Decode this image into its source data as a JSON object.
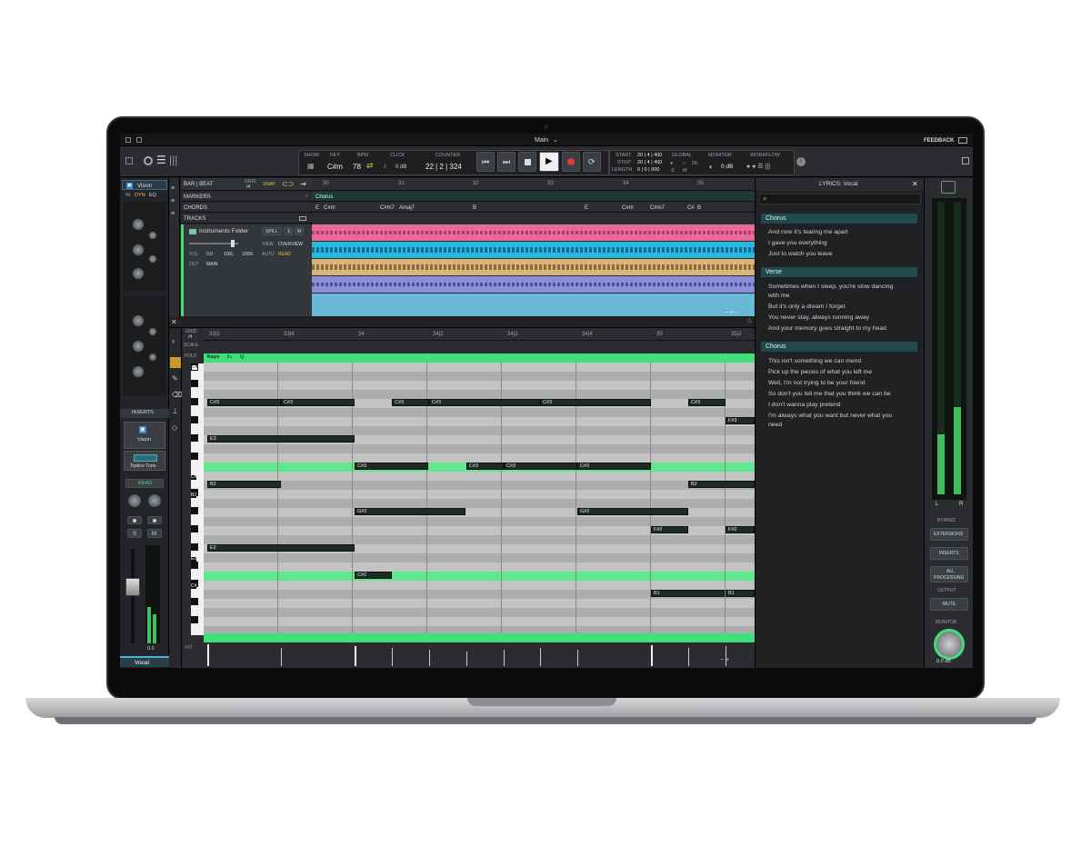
{
  "window": {
    "title": "Main",
    "feedback": "FEEDBACK"
  },
  "toolbar": {
    "show": "SHOW",
    "key_label": "KEY",
    "key": "C#m",
    "bpm_label": "BPM",
    "bpm": "78",
    "click_label": "CLICK",
    "click": "0 dB",
    "counter_label": "COUNTER",
    "counter": "22 | 2 | 324",
    "start_label": "START",
    "start": "20 | 4 | 400",
    "stop_label": "STOP",
    "stop": "20 | 4 | 400",
    "length_label": "LENGTH",
    "length": "0 | 0 | 000",
    "global": "GLOBAL",
    "s": "S",
    "m": "M",
    "ol": "OL",
    "monitor": "MONITOR",
    "monitor_val": "0 dB",
    "workflow": "WORKFLOW"
  },
  "channel": {
    "plugin": "Vision",
    "in": "IN",
    "dyn": "DYN",
    "eq": "EQ",
    "inserts": "INSERTS",
    "insert_1": "Vision",
    "insert_2": "Topline Tune",
    "read": "READ",
    "s": "S",
    "m": "M",
    "name": "Vocal",
    "db": "0.0"
  },
  "arrange": {
    "bar_beat": "BAR | BEAT",
    "grid": "GRID",
    "grid_val": "/4",
    "snap": "SNAP",
    "markers": "MARKERS",
    "chords": "CHORDS",
    "tracks": "TRACKS",
    "folder": "Instruments Folder",
    "spill": "SPILL",
    "s": "S",
    "m": "M",
    "vol": "VOL",
    "vol_val": "0.0",
    "pan_l": "100L",
    "pan_r": "100R",
    "view": "VIEW",
    "view_val": "OVERVIEW",
    "auto": "AUTO",
    "auto_val": "READ",
    "out": "OUT",
    "out_val": "MAIN",
    "bars": [
      "30",
      "31",
      "32",
      "33",
      "34",
      "35"
    ],
    "marker": "Chorus",
    "chord_labels": [
      "E",
      "C#m",
      "C#m7",
      "Amaj7",
      "B",
      "E",
      "C#m",
      "C#m7",
      "C#",
      "B"
    ]
  },
  "piano": {
    "grid": "GRID",
    "grid_val": "/4",
    "scale": "SCALE",
    "fold": "FOLD",
    "keys": "Keys",
    "fit": "FIT",
    "ruler": [
      "33|3",
      "33|4",
      "34",
      "34|2",
      "34|3",
      "34|4",
      "35",
      "35|2"
    ],
    "key_labels": [
      "C4",
      "C#",
      "B2",
      "E2",
      "C#"
    ],
    "notes": [
      "C#3",
      "C#3",
      "C#3",
      "C#3",
      "C#3",
      "C#3",
      "F#3",
      "E3",
      "C#3",
      "C#3",
      "C#3",
      "C#3",
      "B2",
      "B2",
      "G#2",
      "G#2",
      "F#2",
      "F#2",
      "E2",
      "C#2",
      "B1",
      "B1"
    ]
  },
  "lyrics": {
    "title": "LYRICS: Vocal",
    "sections": [
      {
        "name": "Chorus",
        "lines": [
          "And now it's tearing me apart",
          "I gave you everything",
          "Just to watch you leave"
        ]
      },
      {
        "name": "Verse",
        "lines": [
          "Sometimes when I sleep, you're slow dancing",
          "with me",
          "But it's only a dream I forget",
          "You never stay, always running away",
          "And your memory goes straight to my head"
        ]
      },
      {
        "name": "Chorus",
        "lines": [
          "This isn't something we can mend",
          "Pick up the pieces of what you left me",
          "Well, I'm not trying to be your friend",
          "So don't you tell me that you think we can be",
          "I don't wanna play pretend",
          "I'm always what you want but never what you",
          "need"
        ]
      }
    ]
  },
  "monitor_panel": {
    "meter_l": "L",
    "meter_r": "R",
    "bypass": "BYPASS",
    "extensions": "EXTENSIONS",
    "inserts": "INSERTS",
    "all_processing_1": "ALL",
    "all_processing_2": "PROCESSING",
    "output": "OUTPUT",
    "mute": "MUTE",
    "monitor": "MONITOR",
    "monitor_db": "0.0 dB"
  },
  "colors": {
    "accent": "#3fe07a",
    "lyrics_header": "#214a4f",
    "track_pink": "#e86a9a",
    "track_cyan": "#2ab8de",
    "track_tan": "#d9b57a",
    "track_purple": "#8a8fd6"
  }
}
